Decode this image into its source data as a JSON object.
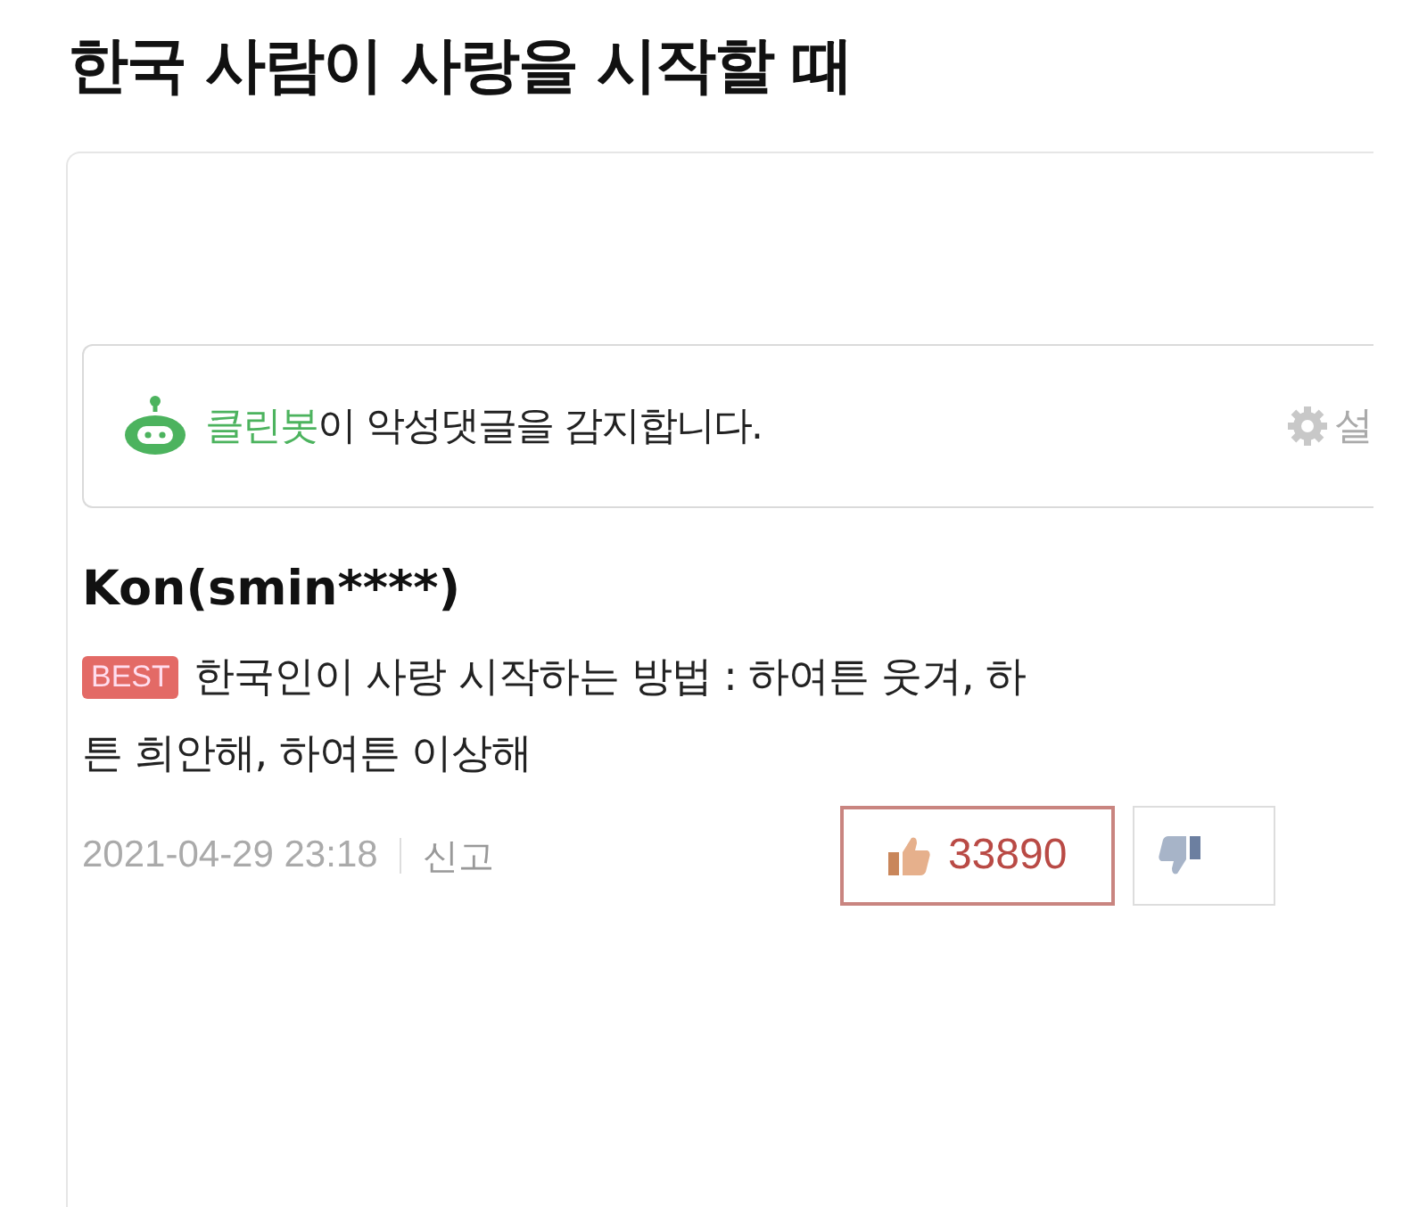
{
  "title": "한국 사람이 사랑을 시작할 때",
  "cleanbot": {
    "name": "클린봇",
    "message": "이 악성댓글을 감지합니다.",
    "settings_label": "설"
  },
  "comment": {
    "author": "Kon(smin****)",
    "badge": "BEST",
    "lines": [
      "한국인이 사랑 시작하는 방법 : 하여튼 웃겨, 하",
      "튼 희안해, 하여튼 이상해"
    ],
    "date": "2021-04-29 23:18",
    "report": "신고",
    "likes": "33890"
  }
}
